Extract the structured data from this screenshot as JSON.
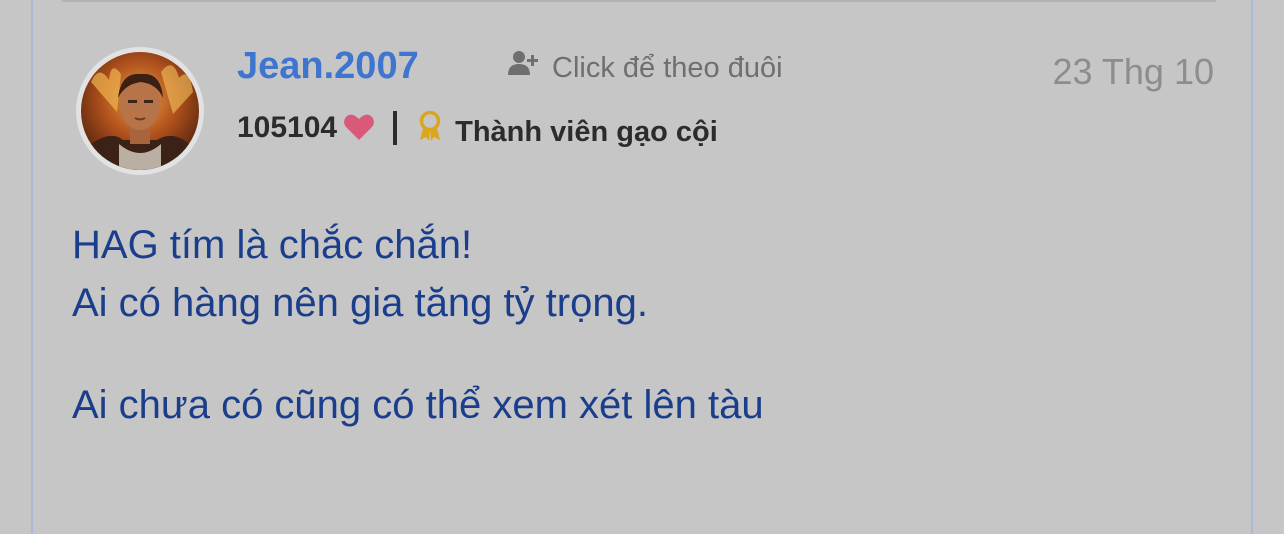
{
  "post": {
    "author": {
      "username": "Jean.2007",
      "points": "105104",
      "rank": "Thành viên gạo cội"
    },
    "follow_label": "Click để theo đuôi",
    "date": "23 Thg 10",
    "content": {
      "line1": "HAG tím là chắc chắn!",
      "line2": "Ai có hàng nên gia tăng tỷ trọng.",
      "line3": "Ai chưa có cũng có thể xem xét lên tàu"
    }
  },
  "colors": {
    "background": "#c6c6c6",
    "username": "#3f74cf",
    "content_text": "#1a3d8c",
    "heart": "#d85a78",
    "rank_badge": "#d9a71e",
    "muted_text": "#6f6f6f"
  },
  "icons": {
    "follow": "user-plus-icon",
    "heart": "heart-icon",
    "rank": "award-ribbon-icon"
  }
}
